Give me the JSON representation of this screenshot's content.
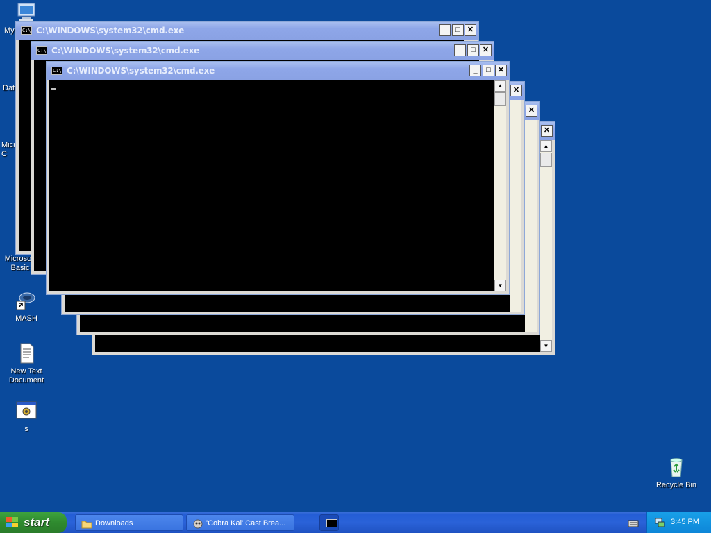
{
  "desktop": {
    "icons": [
      {
        "label": "My"
      },
      {
        "label": "Dat"
      },
      {
        "label": "Micros\nC"
      },
      {
        "label": "Microsoft\nBasic"
      },
      {
        "label": "MASH"
      },
      {
        "label": "New Text\nDocument"
      },
      {
        "label": "s"
      },
      {
        "label": "Recycle Bin"
      }
    ]
  },
  "windows": [
    {
      "title": "C:\\WINDOWS\\system32\\cmd.exe",
      "icon_text": "C:\\",
      "controls": {
        "minimize": "_",
        "maximize": "□",
        "close": "✕"
      }
    },
    {
      "title": "C:\\WINDOWS\\system32\\cmd.exe",
      "icon_text": "C:\\",
      "controls": {
        "minimize": "_",
        "maximize": "□",
        "close": "✕"
      }
    },
    {
      "title": "C:\\WINDOWS\\system32\\cmd.exe",
      "icon_text": "C:\\",
      "controls": {
        "minimize": "_",
        "maximize": "□",
        "close": "✕"
      }
    },
    {
      "title": "",
      "controls": {
        "close": "✕"
      }
    },
    {
      "title": "",
      "controls": {
        "maximize": "□",
        "close": "✕"
      }
    },
    {
      "title": "",
      "controls": {
        "minimize": "_",
        "maximize": "□",
        "close": "✕"
      }
    }
  ],
  "scroll": {
    "up": "▲",
    "down": "▼"
  },
  "taskbar": {
    "start_label": "start",
    "buttons": [
      {
        "label": "Downloads",
        "icon": "folder-icon"
      },
      {
        "label": "'Cobra Kai' Cast Brea...",
        "icon": "browser-icon"
      },
      {
        "label": "",
        "icon": "cmd-icon"
      }
    ],
    "clock": "3:45 PM"
  },
  "colors": {
    "desktop": "#0a4a9c",
    "titlebar_inactive": "#8ea6e8",
    "taskbar": "#245ed6",
    "start": "#2f8a2f",
    "tray": "#0e86d8"
  }
}
